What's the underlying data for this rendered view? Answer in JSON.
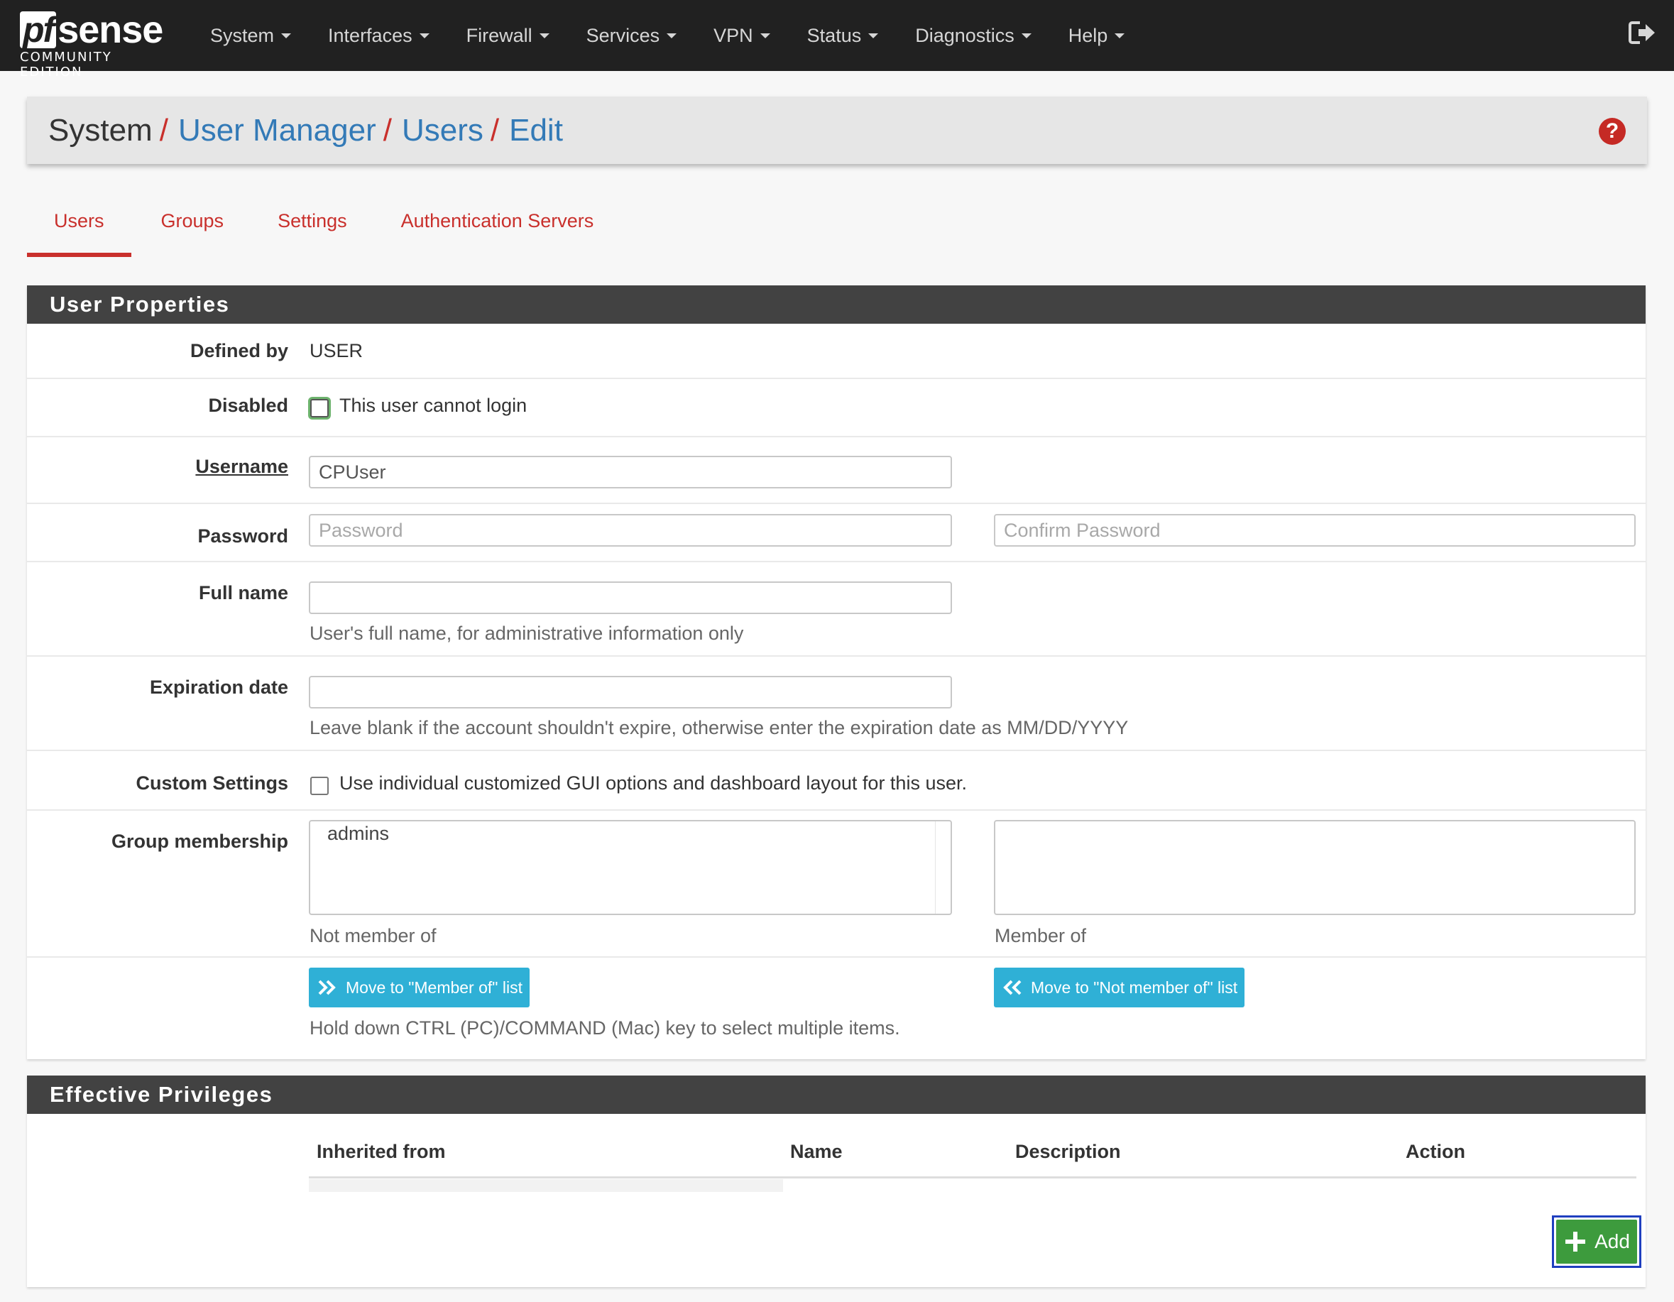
{
  "nav": {
    "logo_pf": "pf",
    "logo_sense": "sense",
    "logo_sub": "COMMUNITY EDITION",
    "items": [
      "System",
      "Interfaces",
      "Firewall",
      "Services",
      "VPN",
      "Status",
      "Diagnostics",
      "Help"
    ]
  },
  "breadcrumb": {
    "root": "System",
    "links": [
      "User Manager",
      "Users",
      "Edit"
    ],
    "separator": "/"
  },
  "tabs": [
    "Users",
    "Groups",
    "Settings",
    "Authentication Servers"
  ],
  "user_properties": {
    "heading": "User Properties",
    "defined_by": {
      "label": "Defined by",
      "value": "USER"
    },
    "disabled": {
      "label": "Disabled",
      "checkbox_label": "This user cannot login"
    },
    "username": {
      "label": "Username",
      "value": "CPUser"
    },
    "password": {
      "label": "Password",
      "placeholder": "Password",
      "confirm_placeholder": "Confirm Password"
    },
    "full_name": {
      "label": "Full name",
      "value": "",
      "help": "User's full name, for administrative information only"
    },
    "expiration": {
      "label": "Expiration date",
      "value": "",
      "help": "Leave blank if the account shouldn't expire, otherwise enter the expiration date as MM/DD/YYYY"
    },
    "custom_settings": {
      "label": "Custom Settings",
      "checkbox_label": "Use individual customized GUI options and dashboard layout for this user."
    },
    "group_membership": {
      "label": "Group membership",
      "not_member_options": [
        "admins"
      ],
      "member_options": [],
      "not_member_caption": "Not member of",
      "member_caption": "Member of",
      "move_to_member": "Move to \"Member of\" list",
      "move_to_not_member": "Move to \"Not member of\" list",
      "help": "Hold down CTRL (PC)/COMMAND (Mac) key to select multiple items."
    }
  },
  "effective_privileges": {
    "heading": "Effective Privileges",
    "columns": [
      "Inherited from",
      "Name",
      "Description",
      "Action"
    ],
    "add_label": "Add"
  },
  "colors": {
    "navbar": "#212121",
    "accent_red": "#c9302c",
    "link_blue": "#337ab7",
    "info_button": "#2fb0d6",
    "success_button": "#3d9b3d"
  }
}
